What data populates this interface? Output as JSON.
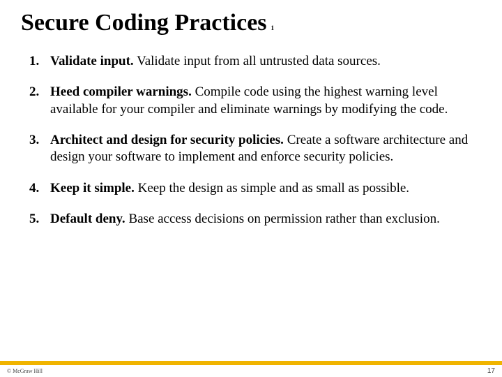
{
  "slide": {
    "title": "Secure Coding Practices",
    "title_suffix": "1",
    "items": [
      {
        "lead": "Validate input.",
        "body": " Validate input from all untrusted data sources."
      },
      {
        "lead": "Heed compiler warnings.",
        "body": " Compile code using the highest warning level available for your compiler and eliminate warnings by modifying the code."
      },
      {
        "lead": "Architect and design for security policies.",
        "body": " Create a software architecture and design your software to implement and enforce security policies."
      },
      {
        "lead": "Keep it simple.",
        "body": " Keep the design as simple and as small as possible."
      },
      {
        "lead": "Default deny.",
        "body": " Base access decisions on permission rather than exclusion."
      }
    ]
  },
  "footer": {
    "copyright": "© McGraw Hill",
    "page": "17"
  }
}
